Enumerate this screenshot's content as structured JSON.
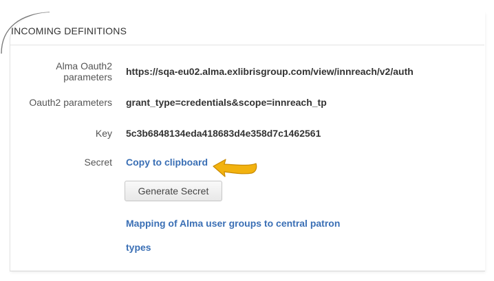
{
  "panel": {
    "title": "INCOMING DEFINITIONS"
  },
  "fields": {
    "alma_oauth2": {
      "label_line1": "Alma Oauth2",
      "label_line2": "parameters",
      "value": "https://sqa-eu02.alma.exlibrisgroup.com/view/innreach/v2/auth"
    },
    "oauth2": {
      "label": "Oauth2 parameters",
      "value": "grant_type=credentials&scope=innreach_tp"
    },
    "key": {
      "label": "Key",
      "value": "5c3b6848134eda418683d4e358d7c1462561"
    },
    "secret": {
      "label": "Secret",
      "copy_link": "Copy to clipboard"
    }
  },
  "actions": {
    "generate_secret": "Generate Secret",
    "mapping_link_line1": "Mapping of Alma user groups to central patron",
    "mapping_link_line2": "types"
  },
  "colors": {
    "link": "#3a6fb5",
    "arrow": "#f2b20f"
  },
  "icons": {
    "pointer": "arrow-pointer-icon"
  }
}
